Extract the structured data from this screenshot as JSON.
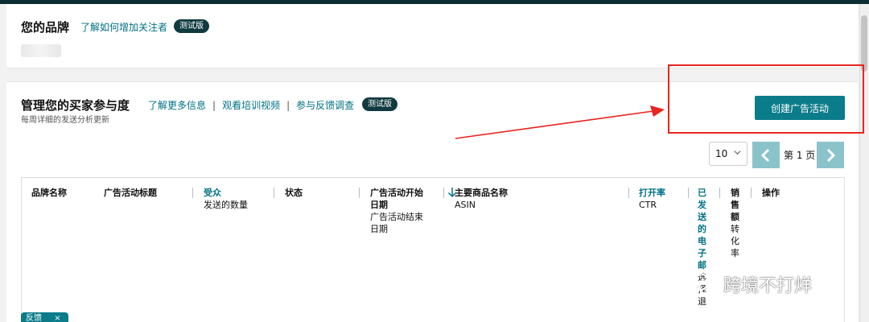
{
  "brand_section": {
    "title": "您的品牌",
    "link": "了解如何增加关注者",
    "badge": "测试版"
  },
  "engagement_section": {
    "title": "管理您的买家参与度",
    "subtitle": "每周详细的发送分析更新",
    "links": [
      "了解更多信息",
      "观看培训视频",
      "参与反馈调查"
    ],
    "badge": "测试版",
    "create_button": "创建广告活动"
  },
  "pagination": {
    "page_size": "10",
    "page_label": "第 1 页"
  },
  "table": {
    "columns": [
      {
        "label": "品牌名称",
        "sub": ""
      },
      {
        "label": "广告活动标题",
        "sub": ""
      },
      {
        "label": "受众",
        "sub": "发送的数量"
      },
      {
        "label": "状态",
        "sub": ""
      },
      {
        "label": "广告活动开始日期",
        "sub": "广告活动结束日期"
      },
      {
        "label": "主要商品名称",
        "sub": "ASIN"
      },
      {
        "label": "打开率",
        "sub": "CTR"
      },
      {
        "label": "已发送的电子邮",
        "sub": "选择退"
      },
      {
        "label": "销售额",
        "sub": "转化率"
      },
      {
        "label": "操作",
        "sub": ""
      }
    ]
  },
  "chip": {
    "label": "反馈",
    "close": "×"
  },
  "watermark": "跨境不打烊",
  "colors": {
    "accent": "#0a7c8a",
    "dark": "#0b2e33",
    "link": "#007185",
    "annotation": "#e8251f"
  }
}
